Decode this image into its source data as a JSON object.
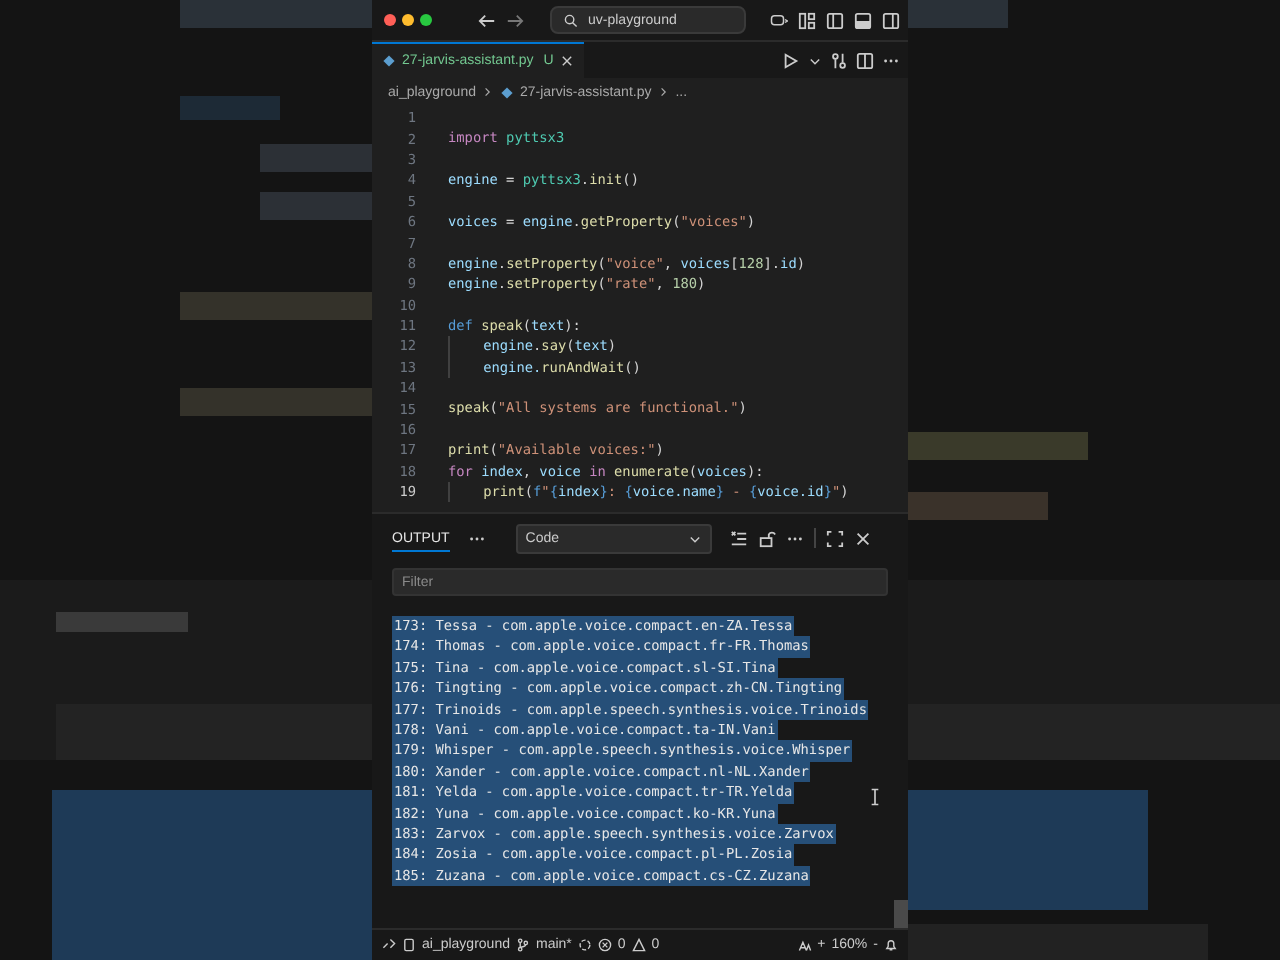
{
  "window": {
    "search": "uv-playground"
  },
  "tab": {
    "label": "27-jarvis-assistant.py",
    "status": "U",
    "selected": true
  },
  "breadcrumbs": [
    "ai_playground",
    "27-jarvis-assistant.py",
    "..."
  ],
  "editor": {
    "lines": [
      {
        "number": "1",
        "current": false
      },
      {
        "number": "2",
        "current": false,
        "indented": false,
        "tokens": [
          {
            "text": "import ",
            "kind": "kw"
          },
          {
            "text": "pyttsx3",
            "kind": "mod"
          }
        ]
      },
      {
        "number": "3",
        "current": false
      },
      {
        "number": "4",
        "current": false,
        "indented": false,
        "tokens": [
          {
            "text": "engine",
            "kind": "var"
          },
          {
            "text": " = ",
            "kind": "p"
          },
          {
            "text": "pyttsx3",
            "kind": "mod"
          },
          {
            "text": ".",
            "kind": "p"
          },
          {
            "text": "init",
            "kind": "fn"
          },
          {
            "text": "()",
            "kind": "p"
          }
        ]
      },
      {
        "number": "5",
        "current": false
      },
      {
        "number": "6",
        "current": false,
        "indented": false,
        "tokens": [
          {
            "text": "voices",
            "kind": "var"
          },
          {
            "text": " = ",
            "kind": "p"
          },
          {
            "text": "engine",
            "kind": "var"
          },
          {
            "text": ".",
            "kind": "p"
          },
          {
            "text": "getProperty",
            "kind": "fn"
          },
          {
            "text": "(",
            "kind": "p"
          },
          {
            "text": "\"voices\"",
            "kind": "str"
          },
          {
            "text": ")",
            "kind": "p"
          }
        ]
      },
      {
        "number": "7",
        "current": false
      },
      {
        "number": "8",
        "current": false,
        "indented": false,
        "tokens": [
          {
            "text": "engine",
            "kind": "var"
          },
          {
            "text": ".",
            "kind": "p"
          },
          {
            "text": "setProperty",
            "kind": "fn"
          },
          {
            "text": "(",
            "kind": "p"
          },
          {
            "text": "\"voice\"",
            "kind": "str"
          },
          {
            "text": ", ",
            "kind": "p"
          },
          {
            "text": "voices",
            "kind": "var"
          },
          {
            "text": "[",
            "kind": "p"
          },
          {
            "text": "128",
            "kind": "num"
          },
          {
            "text": "].",
            "kind": "p"
          },
          {
            "text": "id",
            "kind": "var"
          },
          {
            "text": ")",
            "kind": "p"
          }
        ]
      },
      {
        "number": "9",
        "current": false,
        "indented": false,
        "tokens": [
          {
            "text": "engine",
            "kind": "var"
          },
          {
            "text": ".",
            "kind": "p"
          },
          {
            "text": "setProperty",
            "kind": "fn"
          },
          {
            "text": "(",
            "kind": "p"
          },
          {
            "text": "\"rate\"",
            "kind": "str"
          },
          {
            "text": ", ",
            "kind": "p"
          },
          {
            "text": "180",
            "kind": "num"
          },
          {
            "text": ")",
            "kind": "p"
          }
        ]
      },
      {
        "number": "10",
        "current": false
      },
      {
        "number": "11",
        "current": false,
        "indented": false,
        "tokens": [
          {
            "text": "def ",
            "kind": "def"
          },
          {
            "text": "speak",
            "kind": "fn"
          },
          {
            "text": "(",
            "kind": "p"
          },
          {
            "text": "text",
            "kind": "var"
          },
          {
            "text": "):",
            "kind": "p"
          }
        ]
      },
      {
        "number": "12",
        "current": false,
        "indented": true,
        "tokens": [
          {
            "text": "engine",
            "kind": "var"
          },
          {
            "text": ".",
            "kind": "p"
          },
          {
            "text": "say",
            "kind": "fn"
          },
          {
            "text": "(",
            "kind": "p"
          },
          {
            "text": "text",
            "kind": "var"
          },
          {
            "text": ")",
            "kind": "p"
          }
        ]
      },
      {
        "number": "13",
        "current": false,
        "indented": true,
        "tokens": [
          {
            "text": "engine.",
            "kind": "var"
          },
          {
            "text": "runAndWait",
            "kind": "fn"
          },
          {
            "text": "()",
            "kind": "p"
          }
        ]
      },
      {
        "number": "14",
        "current": false
      },
      {
        "number": "15",
        "current": false,
        "indented": false,
        "tokens": [
          {
            "text": "speak",
            "kind": "fn"
          },
          {
            "text": "(",
            "kind": "p"
          },
          {
            "text": "\"All systems are functional.\"",
            "kind": "str"
          },
          {
            "text": ")",
            "kind": "p"
          }
        ]
      },
      {
        "number": "16",
        "current": false
      },
      {
        "number": "17",
        "current": false,
        "indented": false,
        "tokens": [
          {
            "text": "print",
            "kind": "fn"
          },
          {
            "text": "(",
            "kind": "p"
          },
          {
            "text": "\"Available voices:\"",
            "kind": "str"
          },
          {
            "text": ")",
            "kind": "p"
          }
        ]
      },
      {
        "number": "18",
        "current": false,
        "indented": false,
        "tokens": [
          {
            "text": "for ",
            "kind": "kw"
          },
          {
            "text": "index",
            "kind": "var"
          },
          {
            "text": ", ",
            "kind": "p"
          },
          {
            "text": "voice",
            "kind": "var"
          },
          {
            "text": " in ",
            "kind": "kw"
          },
          {
            "text": "enumerate",
            "kind": "fn"
          },
          {
            "text": "(",
            "kind": "p"
          },
          {
            "text": "voices",
            "kind": "var"
          },
          {
            "text": "):",
            "kind": "p"
          }
        ]
      },
      {
        "number": "19",
        "current": true,
        "indented": true,
        "tokens": [
          {
            "text": "print",
            "kind": "fn"
          },
          {
            "text": "(",
            "kind": "p"
          },
          {
            "text": "f",
            "kind": "def"
          },
          {
            "text": "\"",
            "kind": "str"
          },
          {
            "text": "{",
            "kind": "brace"
          },
          {
            "text": "index",
            "kind": "var"
          },
          {
            "text": "}",
            "kind": "brace"
          },
          {
            "text": ": ",
            "kind": "str"
          },
          {
            "text": "{",
            "kind": "brace"
          },
          {
            "text": "voice.name",
            "kind": "var"
          },
          {
            "text": "}",
            "kind": "brace"
          },
          {
            "text": " - ",
            "kind": "str"
          },
          {
            "text": "{",
            "kind": "brace"
          },
          {
            "text": "voice.id",
            "kind": "var"
          },
          {
            "text": "}",
            "kind": "brace"
          },
          {
            "text": "\"",
            "kind": "str"
          },
          {
            "text": ")",
            "kind": "p"
          }
        ]
      }
    ]
  },
  "output": {
    "tab": "OUTPUT",
    "channel": "Code",
    "filter": {
      "placeholder": "Filter"
    },
    "lines": [
      {
        "text": "173: Tessa - com.apple.voice.compact.en-ZA.Tessa",
        "selected": true
      },
      {
        "text": "174: Thomas - com.apple.voice.compact.fr-FR.Thomas",
        "selected": true
      },
      {
        "text": "175: Tina - com.apple.voice.compact.sl-SI.Tina",
        "selected": true
      },
      {
        "text": "176: Tingting - com.apple.voice.compact.zh-CN.Tingting",
        "selected": true
      },
      {
        "text": "177: Trinoids - com.apple.speech.synthesis.voice.Trinoids",
        "selected": true
      },
      {
        "text": "178: Vani - com.apple.voice.compact.ta-IN.Vani",
        "selected": true
      },
      {
        "text": "179: Whisper - com.apple.speech.synthesis.voice.Whisper",
        "selected": true
      },
      {
        "text": "180: Xander - com.apple.voice.compact.nl-NL.Xander",
        "selected": true
      },
      {
        "text": "181: Yelda - com.apple.voice.compact.tr-TR.Yelda",
        "selected": true
      },
      {
        "text": "182: Yuna - com.apple.voice.compact.ko-KR.Yuna",
        "selected": true
      },
      {
        "text": "183: Zarvox - com.apple.speech.synthesis.voice.Zarvox",
        "selected": true
      },
      {
        "text": "184: Zosia - com.apple.voice.compact.pl-PL.Zosia",
        "selected": true
      },
      {
        "text": "185: Zuzana - com.apple.voice.compact.cs-CZ.Zuzana",
        "selected": true
      }
    ]
  },
  "status_bar": {
    "folder": "ai_playground",
    "branch": "main*",
    "errors": "0",
    "warnings": "0",
    "zoom_in": "+",
    "zoom": "160%",
    "zoom_out": "-"
  }
}
